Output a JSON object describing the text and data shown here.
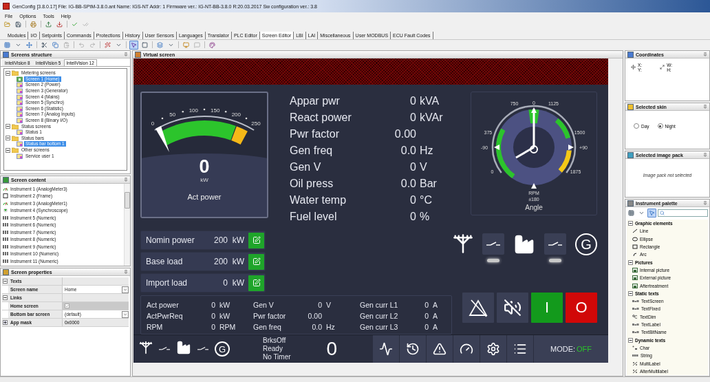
{
  "window": {
    "title": "GenConfig [3.8.0.17]  File: IG-BB-SPtM-3.8.0.ant  Name: IGS-NT  Addr: 1  Firmware ver.: IG-NT-BB-3.8.0 R:20.03.2017  Sw configuration ver.: 3.8"
  },
  "menu": [
    "File",
    "Options",
    "Tools",
    "Help"
  ],
  "tabs": [
    {
      "label": "Modules",
      "selected": false
    },
    {
      "label": "I/O",
      "selected": false
    },
    {
      "label": "Setpoints",
      "selected": false
    },
    {
      "label": "Commands",
      "selected": false
    },
    {
      "label": "Protections",
      "selected": false
    },
    {
      "label": "History",
      "selected": false
    },
    {
      "label": "User Sensors",
      "selected": false
    },
    {
      "label": "Languages",
      "selected": false
    },
    {
      "label": "Translator",
      "selected": false
    },
    {
      "label": "PLC Editor",
      "selected": false
    },
    {
      "label": "Screen Editor",
      "selected": true
    },
    {
      "label": "LBI",
      "selected": false
    },
    {
      "label": "LAI",
      "selected": false
    },
    {
      "label": "Miscellaneous",
      "selected": false
    },
    {
      "label": "User MODBUS",
      "selected": false
    },
    {
      "label": "ECU Fault Codes",
      "selected": false
    }
  ],
  "screens_structure": {
    "title": "Screens structure",
    "tabs": [
      {
        "label": "InteliVision 8",
        "selected": false
      },
      {
        "label": "InteliVision 5",
        "selected": false
      },
      {
        "label": "InteliVision 12",
        "selected": true
      }
    ],
    "tree": [
      {
        "label": "Metering screens",
        "kind": "folder",
        "expanded": true,
        "selected": false,
        "children": [
          {
            "label": "Screen 1 (Home)",
            "kind": "home",
            "selected": true
          },
          {
            "label": "Screen 2 (Power)",
            "kind": "screen",
            "selected": false
          },
          {
            "label": "Screen 3 (Generator)",
            "kind": "screen",
            "selected": false
          },
          {
            "label": "Screen 4 (Mains)",
            "kind": "screen",
            "selected": false
          },
          {
            "label": "Screen 5 (Synchro)",
            "kind": "screen",
            "selected": false
          },
          {
            "label": "Screen 6 (Statistic)",
            "kind": "screen",
            "selected": false
          },
          {
            "label": "Screen 7 (Analog Inputs)",
            "kind": "screen",
            "selected": false
          },
          {
            "label": "Screen 8 (Binary I/O)",
            "kind": "screen",
            "selected": false
          }
        ]
      },
      {
        "label": "Status screens",
        "kind": "folder",
        "expanded": true,
        "selected": false,
        "children": [
          {
            "label": "Status 1",
            "kind": "screen",
            "selected": false
          }
        ]
      },
      {
        "label": "Status bars",
        "kind": "folder",
        "expanded": true,
        "selected": false,
        "children": [
          {
            "label": "Status bar bottom 1",
            "kind": "screen",
            "selected": true
          }
        ]
      },
      {
        "label": "Other screens",
        "kind": "folder",
        "expanded": true,
        "selected": false,
        "children": [
          {
            "label": "Service user 1",
            "kind": "screen",
            "selected": false
          }
        ]
      }
    ]
  },
  "screen_content": {
    "title": "Screen content",
    "items": [
      {
        "label": "Instrument 1 (AnalogMeter3)",
        "kind": "analog-meter"
      },
      {
        "label": "Instrument 2 (Frame)",
        "kind": "frame"
      },
      {
        "label": "Instrument 3 (AnalogMeter1)",
        "kind": "analog-meter"
      },
      {
        "label": "Instrument 4 (Synchroscope)",
        "kind": "synchroscope"
      },
      {
        "label": "Instrument 5 (Numeric)",
        "kind": "numeric"
      },
      {
        "label": "Instrument 6 (Numeric)",
        "kind": "numeric"
      },
      {
        "label": "Instrument 7 (Numeric)",
        "kind": "numeric"
      },
      {
        "label": "Instrument 8 (Numeric)",
        "kind": "numeric"
      },
      {
        "label": "Instrument 9 (Numeric)",
        "kind": "numeric"
      },
      {
        "label": "Instrument 10 (Numeric)",
        "kind": "numeric"
      },
      {
        "label": "Instrument 11 (Numeric)",
        "kind": "numeric"
      }
    ]
  },
  "screen_properties": {
    "title": "Screen properties",
    "rows": [
      {
        "kind": "group",
        "label": "Texts",
        "expanded": true
      },
      {
        "kind": "dropdown",
        "label": "Screen name",
        "value": "Home"
      },
      {
        "kind": "group",
        "label": "Links",
        "expanded": true
      },
      {
        "kind": "checkbox",
        "label": "Home screen",
        "checked": true,
        "disabled": true
      },
      {
        "kind": "dropdown",
        "label": "Bottom bar screen",
        "value": "(default)"
      },
      {
        "kind": "group",
        "label": "App mask",
        "expanded": false,
        "value": "0x0000"
      }
    ]
  },
  "virtual_screen": {
    "title": "Virtual screen",
    "gauge": {
      "ticks": [
        "0",
        "50",
        "100",
        "150",
        "200",
        "250"
      ],
      "value": "0",
      "unit": "kW",
      "label": "Act power"
    },
    "readings": [
      {
        "label": "Appar pwr",
        "value": "0",
        "unit": "kVA"
      },
      {
        "label": "React power",
        "value": "0",
        "unit": "kVAr"
      },
      {
        "label": "Pwr factor",
        "value": "0.00"
      },
      {
        "label": "Gen freq",
        "value": "0.0",
        "unit": "Hz"
      },
      {
        "label": "Gen V",
        "value": "0",
        "unit": "V"
      },
      {
        "label": "Oil press",
        "value": "0.0",
        "unit": "Bar"
      },
      {
        "label": "Water temp",
        "value": "0",
        "unit": "°C"
      },
      {
        "label": "Fuel level",
        "value": "0",
        "unit": "%"
      }
    ],
    "synchroscope": {
      "rpm_ticks": [
        "0",
        "375",
        "750",
        "1125",
        "1500",
        "1875"
      ],
      "angle_ticks": [
        "-90",
        "0",
        "+90"
      ],
      "rpm_label": "RPM",
      "angle_value": "±180",
      "label": "Angle"
    },
    "setpoints": [
      {
        "label": "Nomin power",
        "value": "200",
        "unit": "kW"
      },
      {
        "label": "Base load",
        "value": "200",
        "unit": "kW"
      },
      {
        "label": "Import load",
        "value": "0",
        "unit": "kW"
      }
    ],
    "diagram": {
      "breakers": [
        {
          "closed": false
        },
        {
          "closed": false
        }
      ],
      "generator_symbol": "G"
    },
    "controls": {
      "start": "I",
      "stop": "O"
    },
    "table": {
      "rows": [
        {
          "cells": [
            {
              "label": "Act power",
              "value": "0",
              "unit": "kW"
            },
            {
              "label": "Gen V",
              "value": "0",
              "unit": "V"
            },
            {
              "label": "Gen curr L1",
              "value": "0",
              "unit": "A"
            }
          ]
        },
        {
          "cells": [
            {
              "label": "ActPwrReq",
              "value": "0",
              "unit": "kW"
            },
            {
              "label": "Pwr factor",
              "value": "0.00"
            },
            {
              "label": "Gen curr L2",
              "value": "0",
              "unit": "A"
            }
          ]
        },
        {
          "cells": [
            {
              "label": "RPM",
              "value": "0",
              "unit": "RPM"
            },
            {
              "label": "Gen freq",
              "value": "0.0",
              "unit": "Hz"
            },
            {
              "label": "Gen curr L3",
              "value": "0",
              "unit": "A"
            }
          ]
        }
      ]
    },
    "bottom_bar": {
      "breakers": [
        {
          "closed": false
        },
        {
          "closed": false
        }
      ],
      "generator_symbol": "G",
      "status_lines": [
        "BrksOff",
        "Ready",
        "No Timer"
      ],
      "counter": "0",
      "mode_label": "MODE:",
      "mode_value": "OFF"
    }
  },
  "coordinates": {
    "title": "Coordinates",
    "position_labels": [
      "X:",
      "Y:"
    ],
    "size_labels": [
      "W:",
      "H:"
    ]
  },
  "selected_skin": {
    "title": "Selected skin",
    "options": [
      {
        "label": "Day",
        "selected": false
      },
      {
        "label": "Night",
        "selected": true
      }
    ]
  },
  "image_pack": {
    "title": "Selected image pack",
    "message": "Image pack not selected"
  },
  "instrument_palette": {
    "title": "Instrument palette",
    "groups": [
      {
        "label": "Graphic elements",
        "expanded": true,
        "items": [
          {
            "label": "Line",
            "kind": "line"
          },
          {
            "label": "Ellipse",
            "kind": "ellipse"
          },
          {
            "label": "Rectangle",
            "kind": "rectangle"
          },
          {
            "label": "Arc",
            "kind": "arc"
          }
        ]
      },
      {
        "label": "Pictures",
        "expanded": true,
        "items": [
          {
            "label": "Internal picture",
            "kind": "picture"
          },
          {
            "label": "External picture",
            "kind": "picture"
          },
          {
            "label": "Aftertreatment",
            "kind": "picture"
          }
        ]
      },
      {
        "label": "Static texts",
        "expanded": true,
        "items": [
          {
            "label": "TextScreen",
            "kind": "text"
          },
          {
            "label": "TextFixed",
            "kind": "text"
          },
          {
            "label": "TextDim",
            "kind": "dim"
          },
          {
            "label": "TextLabel",
            "kind": "text"
          },
          {
            "label": "TextBitName",
            "kind": "text"
          }
        ]
      },
      {
        "label": "Dynamic texts",
        "expanded": true,
        "items": [
          {
            "label": "Char",
            "kind": "char"
          },
          {
            "label": "String",
            "kind": "string"
          },
          {
            "label": "MultiLabel",
            "kind": "multilabel"
          },
          {
            "label": "AlterMultilabel",
            "kind": "multilabel"
          }
        ]
      }
    ]
  }
}
